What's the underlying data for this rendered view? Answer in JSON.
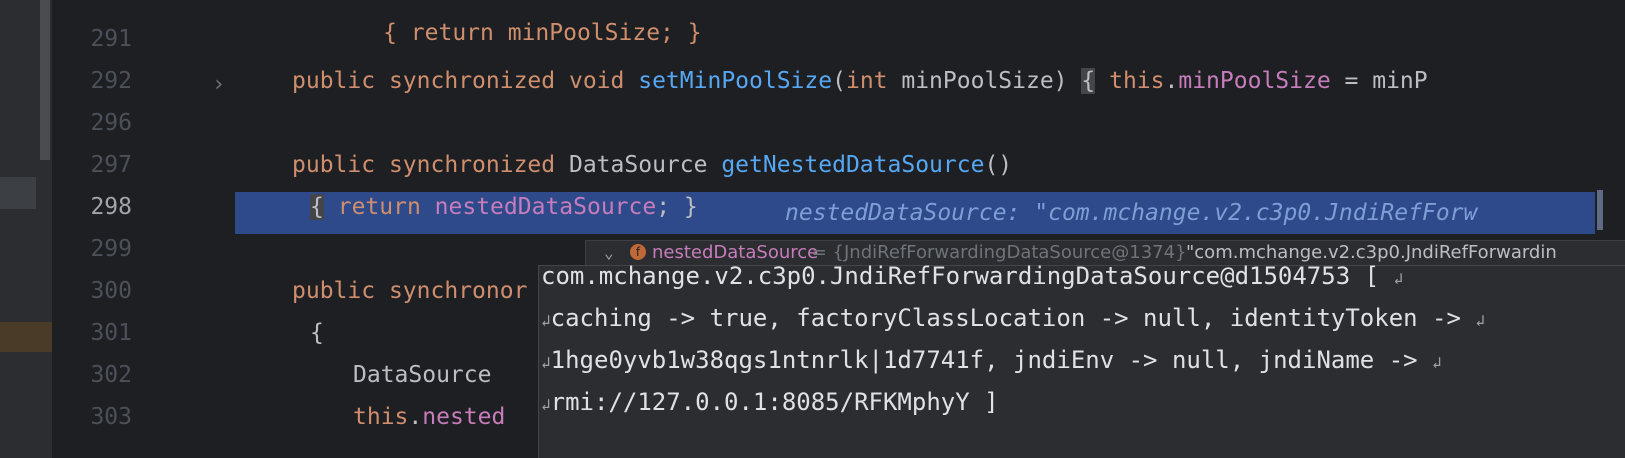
{
  "gutter": {
    "lines": [
      "291",
      "292",
      "296",
      "297",
      "298",
      "299",
      "300",
      "301",
      "302",
      "303"
    ],
    "current_line": "298"
  },
  "code": {
    "line290": "{ return minPoolSize; }",
    "line292": {
      "kw1": "public",
      "kw2": "synchronized",
      "kw3": "void",
      "method": "setMinPoolSize",
      "open": "(",
      "param_type": "int",
      "param_name": " minPoolSize)",
      "brace": "{",
      "this": "this",
      "dot": ".",
      "field": "minPoolSize",
      "rest": " = minP"
    },
    "line297": {
      "kw1": "public",
      "kw2": "synchronized",
      "type": "DataSource",
      "method": "getNestedDataSource",
      "parens": "()"
    },
    "line298": {
      "open": "{",
      "kw": "return",
      "field": "nestedDataSource",
      "close": "; }",
      "hint": "nestedDataSource: \"com.mchange.v2.c3p0.JndiRefForw"
    },
    "line300": {
      "kw1": "public",
      "kw2": "synchronor"
    },
    "line301": "{",
    "line302": "DataSource",
    "line303": {
      "this": "this",
      "dot": ".",
      "field": "nested"
    }
  },
  "debug_popup": {
    "expand": "⌄",
    "badge": "f",
    "name": "nestedDataSource",
    "type": " = {JndiRefForwardingDataSource@1374} ",
    "value": "\"com.mchange.v2.c3p0.JndiRefForwardin"
  },
  "tooltip": {
    "line1": "com.mchange.v2.c3p0.JndiRefForwardingDataSource@d1504753 [",
    "line2": "caching -> true, factoryClassLocation -> null, identityToken ->",
    "line3": "1hge0yvb1w38qgs1ntnrlk|1d7741f, jndiEnv -> null, jndiName ->",
    "line4": "rmi://127.0.0.1:8085/RFKMphyY ]",
    "wrap_glyph": "↲"
  },
  "icons": {
    "fold": "›",
    "wrap": "↲"
  }
}
